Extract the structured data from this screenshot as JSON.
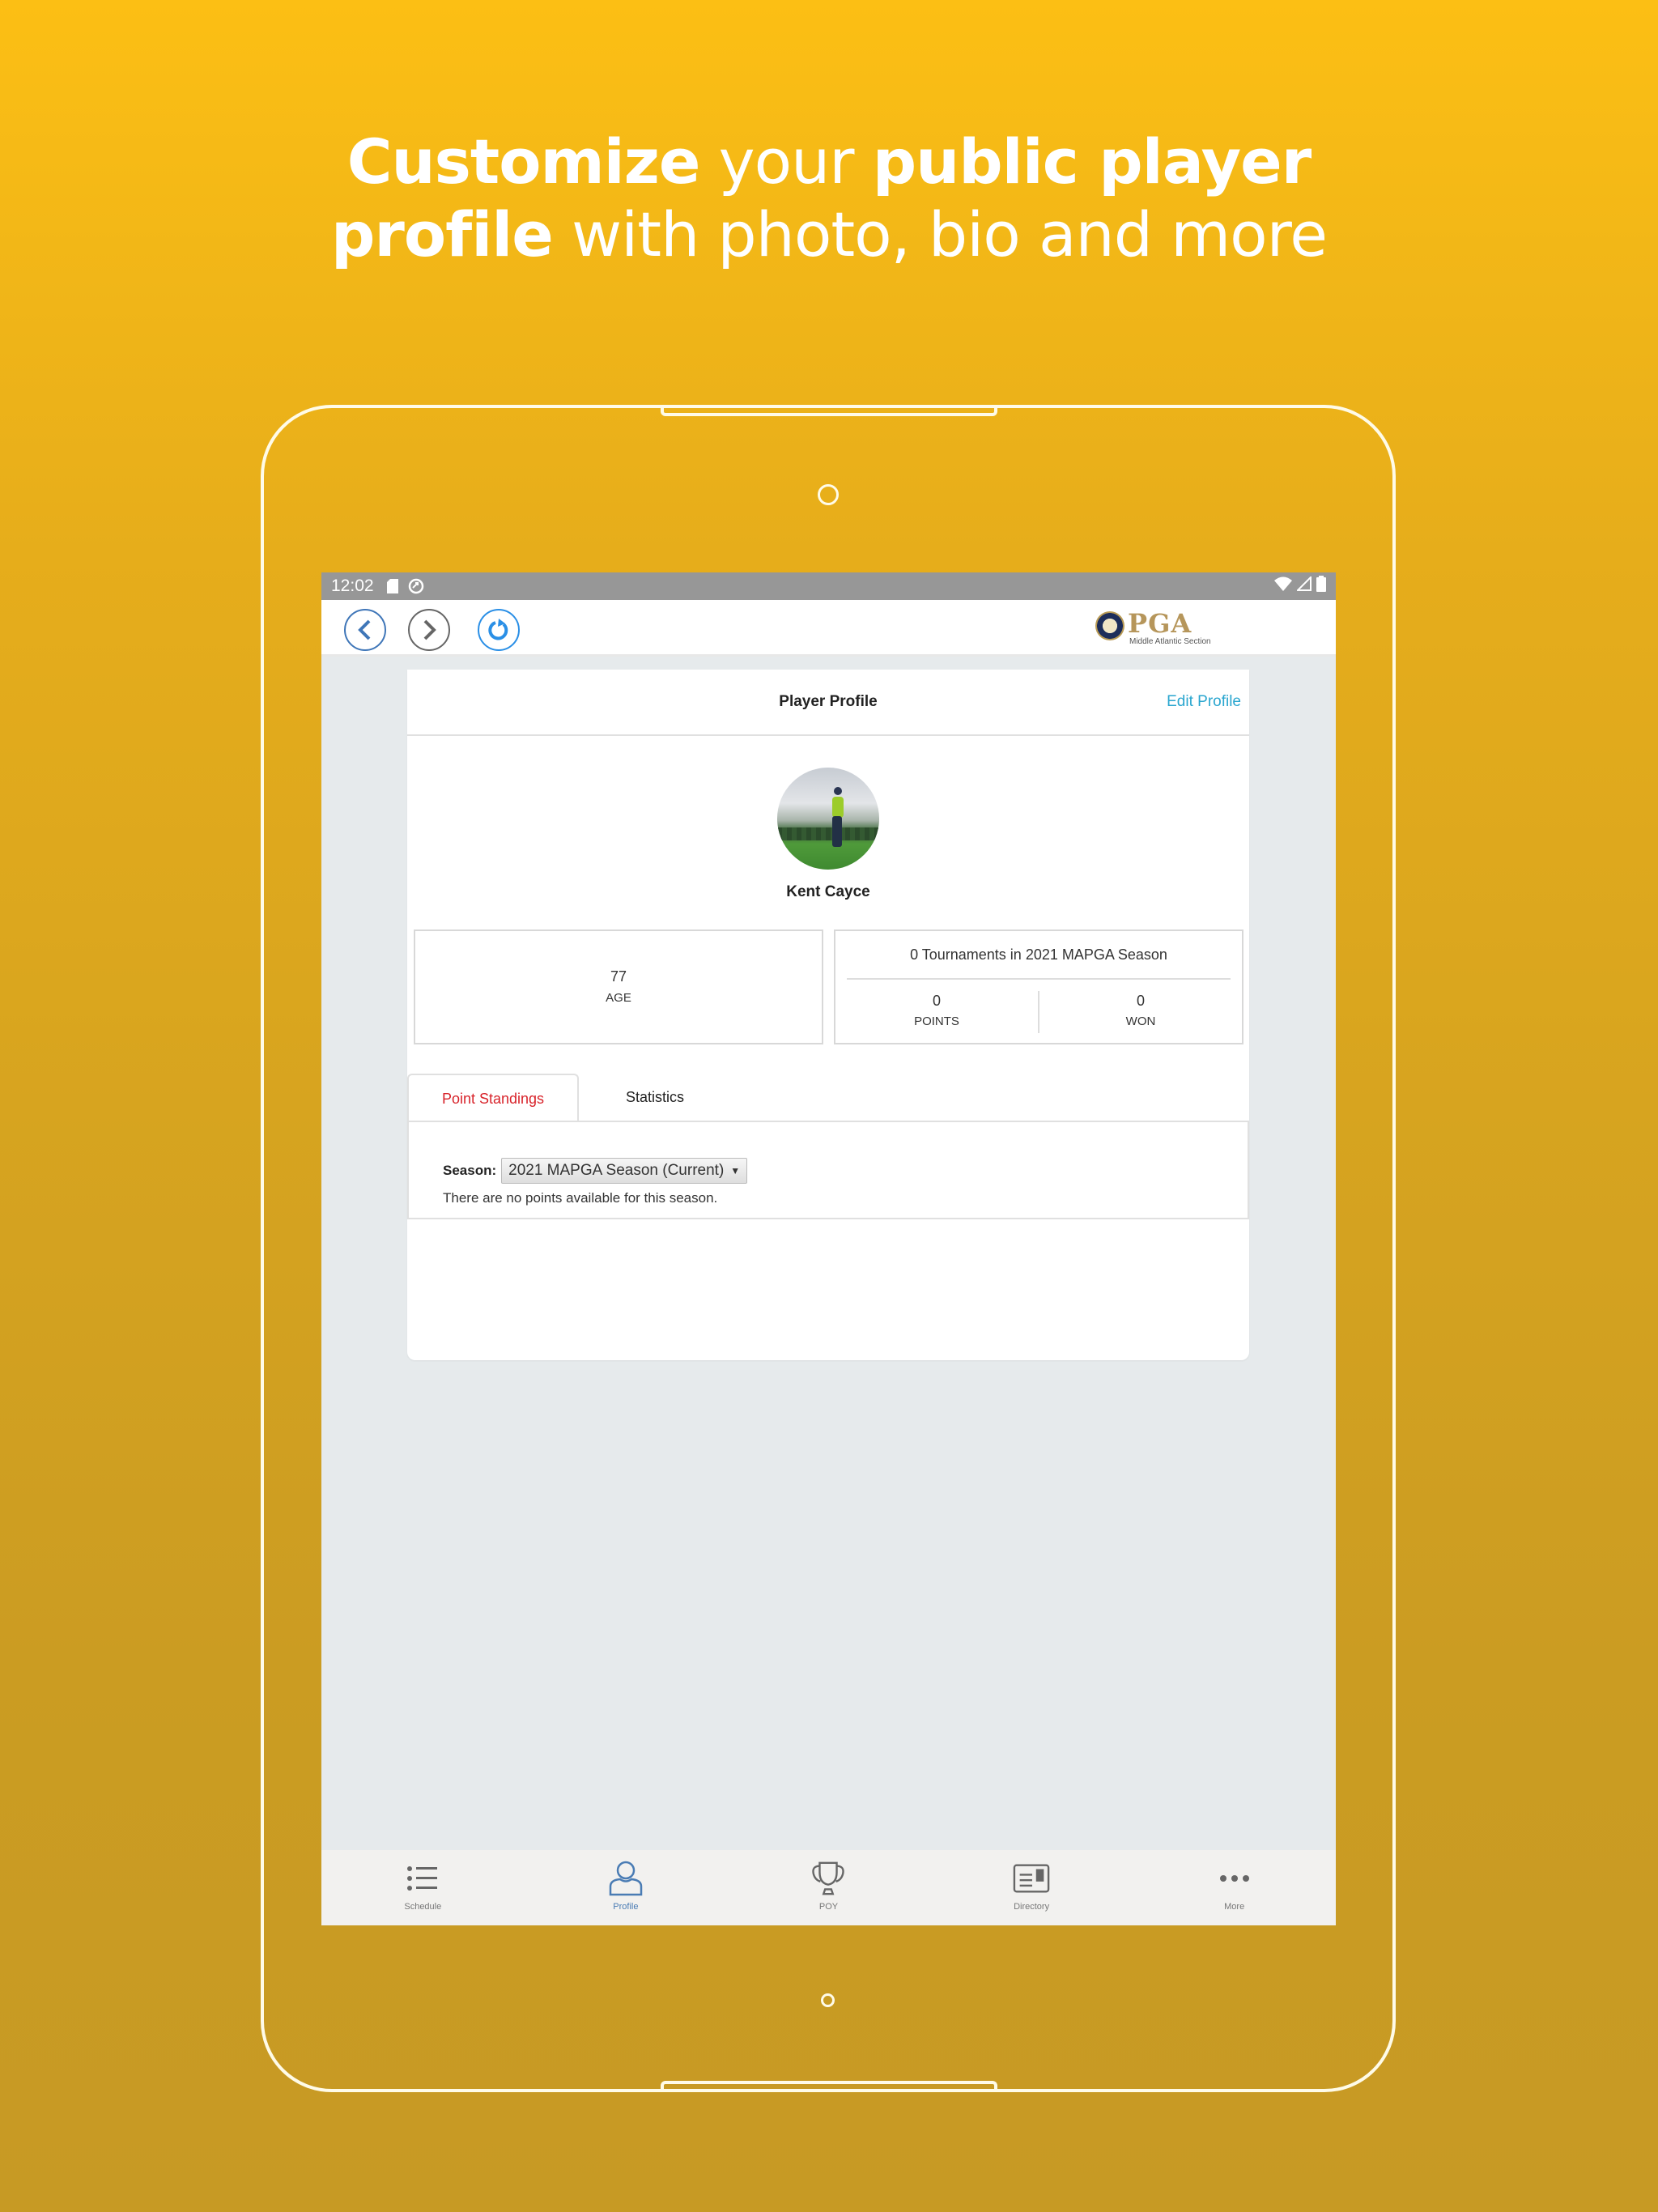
{
  "headline": {
    "line1_bold_a": "Customize",
    "line1_light": "your",
    "line1_bold_b": "public player",
    "line2_bold": "profile",
    "line2_light": "with photo, bio and more"
  },
  "statusbar": {
    "time": "12:02",
    "left_icons": [
      "sd-card-icon",
      "sync-icon"
    ],
    "right_icons": [
      "wifi-icon",
      "signal-icon",
      "battery-icon"
    ]
  },
  "appbar": {
    "buttons": [
      "back",
      "forward",
      "refresh"
    ],
    "logo": {
      "text": "PGA",
      "subtitle": "Middle Atlantic Section"
    }
  },
  "page": {
    "title": "Player Profile",
    "edit_label": "Edit Profile"
  },
  "player": {
    "name": "Kent Cayce",
    "age_value": "77",
    "age_label": "AGE"
  },
  "season_summary": {
    "heading": "0 Tournaments in 2021 MAPGA Season",
    "points_value": "0",
    "points_label": "POINTS",
    "won_value": "0",
    "won_label": "WON"
  },
  "tabs": [
    {
      "label": "Point Standings",
      "active": true
    },
    {
      "label": "Statistics",
      "active": false
    }
  ],
  "standings": {
    "season_label": "Season:",
    "season_selected": "2021 MAPGA Season (Current)",
    "empty_message": "There are no points available for this season."
  },
  "bottom_nav": [
    {
      "label": "Schedule",
      "icon": "list-icon",
      "active": false
    },
    {
      "label": "Profile",
      "icon": "user-icon",
      "active": true
    },
    {
      "label": "POY",
      "icon": "trophy-icon",
      "active": false
    },
    {
      "label": "Directory",
      "icon": "id-card-icon",
      "active": false
    },
    {
      "label": "More",
      "icon": "more-dots-icon",
      "active": false
    }
  ],
  "colors": {
    "accent_blue": "#2aa6cf",
    "active_tab_red": "#d8232a",
    "nav_active": "#4a7cb4",
    "pga_gold": "#b6965b"
  }
}
